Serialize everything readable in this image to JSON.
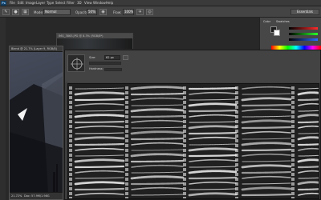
{
  "app": {
    "logo_text": "Ps"
  },
  "menubar": {
    "items": [
      "File",
      "Edit",
      "Image",
      "Layer",
      "Type",
      "Select",
      "Filter",
      "3D",
      "View",
      "Window",
      "Help"
    ]
  },
  "options": {
    "mode_label": "Mode:",
    "mode_value": "Normal",
    "opacity_label": "Opacity:",
    "opacity_value": "50%",
    "flow_label": "Flow:",
    "flow_value": "100%",
    "workspace": "Essentials"
  },
  "background_document": {
    "title": "IMG_3863.JPG @ 8.3% (RGB/8*)"
  },
  "document": {
    "title": "Blend @ 21.7% (Layer 9, RGB/8)",
    "zoom": "21.72%",
    "doc_size": "Doc: 57.9M/1.98G"
  },
  "right_panel": {
    "tabs": [
      "Color",
      "Swatches"
    ],
    "colors": {
      "foreground": "#1a1a1a",
      "background": "#ffffff"
    }
  },
  "brush_panel": {
    "size_label": "Size:",
    "size_value": "62 px",
    "hardness_label": "Hardness:"
  }
}
